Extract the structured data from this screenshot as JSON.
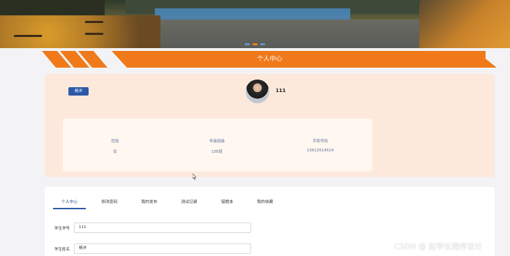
{
  "banner": {
    "carousel_slides": 3,
    "active_slide": 2
  },
  "section": {
    "title": "个人中心"
  },
  "profile": {
    "badge": "杨洋",
    "username": "111",
    "fields": [
      {
        "label": "性别",
        "value": "女"
      },
      {
        "label": "年级班级",
        "value": "105班"
      },
      {
        "label": "手机号码",
        "value": "13612514514"
      }
    ]
  },
  "tabs": [
    {
      "label": "个人中心",
      "active": true
    },
    {
      "label": "修改密码",
      "active": false
    },
    {
      "label": "我的发布",
      "active": false
    },
    {
      "label": "测试记录",
      "active": false
    },
    {
      "label": "错题本",
      "active": false
    },
    {
      "label": "我的收藏",
      "active": false
    }
  ],
  "form": {
    "student_id": {
      "label": "学生学号",
      "value": "111"
    },
    "student_name": {
      "label": "学生姓名",
      "value": "杨洋"
    }
  },
  "watermark": "CSDN @ 赵学长程序设计",
  "colors": {
    "accent": "#f07a1a",
    "primary": "#2d5aa8",
    "profile_bg": "#fde9dc"
  }
}
